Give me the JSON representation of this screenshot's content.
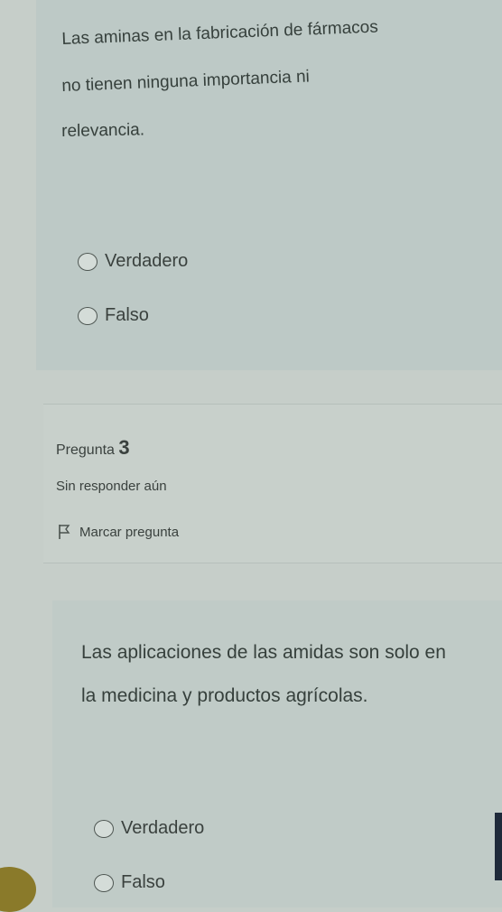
{
  "question2": {
    "text_lines": [
      "Las aminas en la fabricación de fármacos",
      "no tienen ninguna importancia ni",
      "relevancia."
    ],
    "options": [
      "Verdadero",
      "Falso"
    ]
  },
  "question3": {
    "label": "Pregunta",
    "number": "3",
    "status": "Sin responder aún",
    "flag_label": "Marcar pregunta",
    "text_lines": [
      "Las aplicaciones de las amidas son solo en",
      "la medicina y productos agrícolas."
    ],
    "options": [
      "Verdadero",
      "Falso"
    ]
  },
  "icons": [
    "radio-icon",
    "flag-icon"
  ]
}
